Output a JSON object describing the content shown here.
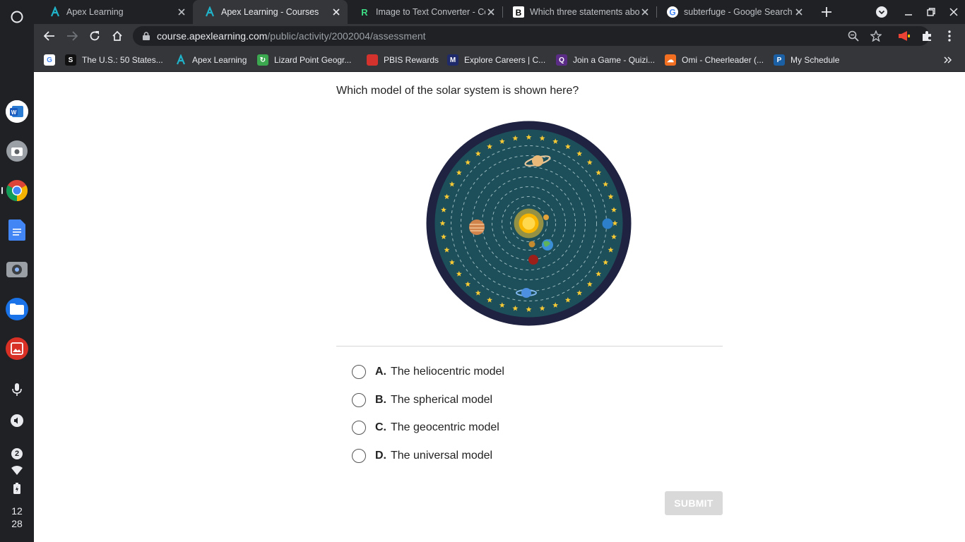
{
  "tabs": [
    {
      "title": "Apex Learning",
      "favicon": "apex-icon"
    },
    {
      "title": "Apex Learning - Courses",
      "favicon": "apex-icon",
      "active": true
    },
    {
      "title": "Image to Text Converter - Co",
      "favicon": "r-icon"
    },
    {
      "title": "Which three statements abo",
      "favicon": "brainly-icon"
    },
    {
      "title": "subterfuge - Google Search",
      "favicon": "google-icon"
    }
  ],
  "address_bar": {
    "domain": "course.apexlearning.com",
    "path": "/public/activity/2002004/assessment"
  },
  "bookmarks": [
    {
      "label": "The U.S.: 50 States...",
      "color": "#111111"
    },
    {
      "label": "Apex Learning",
      "color": "#2bb3b3"
    },
    {
      "label": "Lizard Point Geogr...",
      "color": "#3ba84f"
    },
    {
      "label": "PBIS Rewards",
      "color": "#d4322c"
    },
    {
      "label": "Explore Careers | C...",
      "color": "#1f2a6b"
    },
    {
      "label": "Join a Game - Quizi...",
      "color": "#5b2c86"
    },
    {
      "label": "Omi - Cheerleader (...",
      "color": "#f26f21"
    },
    {
      "label": "My Schedule",
      "color": "#1b5fa5"
    }
  ],
  "clock": {
    "hour": "12",
    "minute": "28"
  },
  "shelf_badge": "2",
  "question": "Which model of the solar system is shown here?",
  "options": [
    {
      "letter": "A.",
      "text": "The heliocentric model"
    },
    {
      "letter": "B.",
      "text": "The spherical model"
    },
    {
      "letter": "C.",
      "text": "The geocentric model"
    },
    {
      "letter": "D.",
      "text": "The universal model"
    }
  ],
  "submit_label": "SUBMIT",
  "colors": {
    "chrome_dark": "#202124",
    "chrome_toolbar": "#35363a",
    "figure_ring": "#1f2341",
    "figure_sky": "#1d4f5a",
    "submit_disabled": "#d9d9d9"
  }
}
